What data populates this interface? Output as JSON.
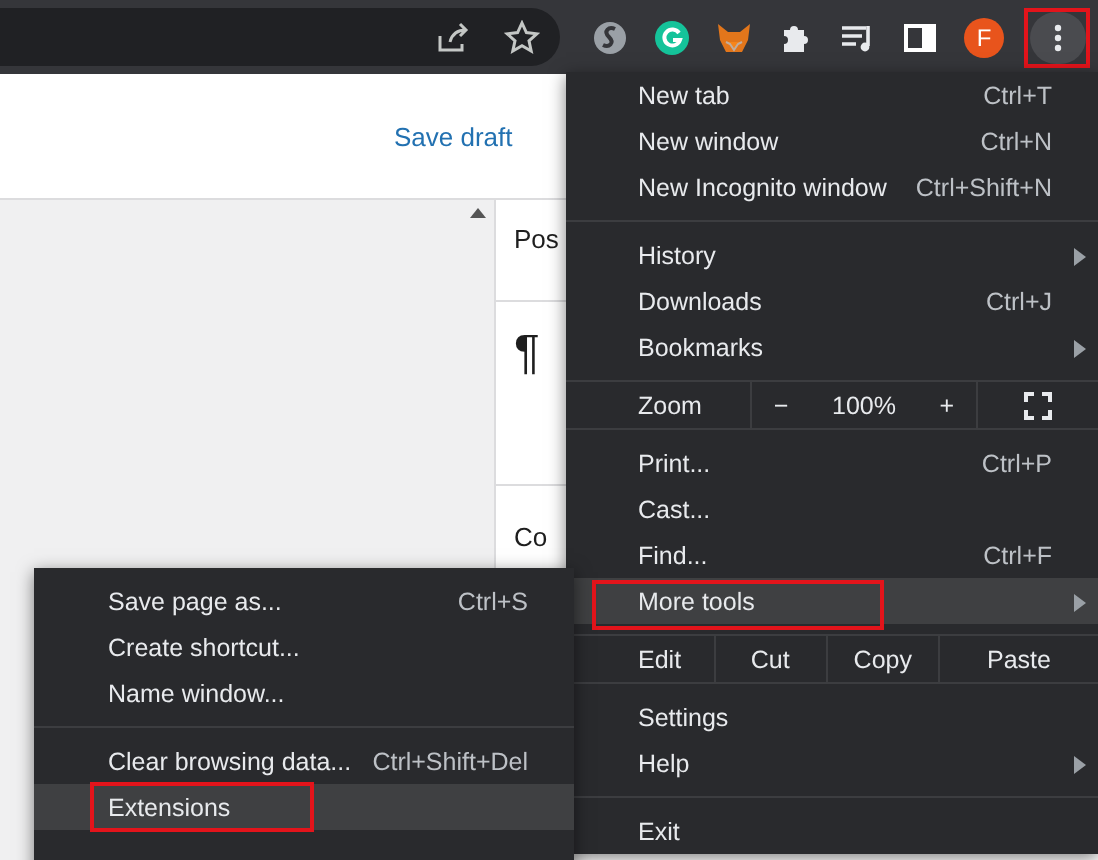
{
  "toolbar": {
    "avatar": "F",
    "menu_button": {
      "annotated": true
    }
  },
  "page": {
    "header_links": [
      "Save draft"
    ],
    "panel_texts": [
      "Pos",
      "¶",
      "Co"
    ]
  },
  "main_menu": {
    "items": [
      {
        "kind": "item",
        "label": "New tab",
        "shortcut": "Ctrl+T",
        "submenu": false,
        "hovered": false,
        "annotated": false
      },
      {
        "kind": "item",
        "label": "New window",
        "shortcut": "Ctrl+N",
        "submenu": false,
        "hovered": false,
        "annotated": false
      },
      {
        "kind": "item",
        "label": "New Incognito window",
        "shortcut": "Ctrl+Shift+N",
        "submenu": false,
        "hovered": false,
        "annotated": false
      },
      {
        "kind": "separator"
      },
      {
        "kind": "item",
        "label": "History",
        "submenu": true,
        "hovered": false,
        "annotated": false
      },
      {
        "kind": "item",
        "label": "Downloads",
        "shortcut": "Ctrl+J",
        "submenu": false,
        "hovered": false,
        "annotated": false
      },
      {
        "kind": "item",
        "label": "Bookmarks",
        "submenu": true,
        "hovered": false,
        "annotated": false
      },
      {
        "kind": "separator"
      },
      {
        "kind": "zoom",
        "label": "Zoom",
        "minus": "−",
        "value": "100%",
        "plus": "+"
      },
      {
        "kind": "separator"
      },
      {
        "kind": "item",
        "label": "Print...",
        "shortcut": "Ctrl+P",
        "submenu": false,
        "hovered": false,
        "annotated": false
      },
      {
        "kind": "item",
        "label": "Cast...",
        "submenu": false,
        "hovered": false,
        "annotated": false
      },
      {
        "kind": "item",
        "label": "Find...",
        "shortcut": "Ctrl+F",
        "submenu": false,
        "hovered": false,
        "annotated": false
      },
      {
        "kind": "item",
        "label": "More tools",
        "submenu": true,
        "hovered": true,
        "annotated": true
      },
      {
        "kind": "separator"
      },
      {
        "kind": "edit",
        "label": "Edit",
        "actions": [
          "Cut",
          "Copy",
          "Paste"
        ]
      },
      {
        "kind": "separator"
      },
      {
        "kind": "item",
        "label": "Settings",
        "submenu": false,
        "hovered": false,
        "annotated": false
      },
      {
        "kind": "item",
        "label": "Help",
        "submenu": true,
        "hovered": false,
        "annotated": false
      },
      {
        "kind": "separator"
      },
      {
        "kind": "item",
        "label": "Exit",
        "submenu": false,
        "hovered": false,
        "annotated": false
      }
    ]
  },
  "more_tools_menu": {
    "items": [
      {
        "kind": "item",
        "label": "Save page as...",
        "shortcut": "Ctrl+S",
        "hovered": false,
        "annotated": false
      },
      {
        "kind": "item",
        "label": "Create shortcut...",
        "hovered": false,
        "annotated": false
      },
      {
        "kind": "item",
        "label": "Name window...",
        "hovered": false,
        "annotated": false
      },
      {
        "kind": "separator"
      },
      {
        "kind": "item",
        "label": "Clear browsing data...",
        "shortcut": "Ctrl+Shift+Del",
        "hovered": false,
        "annotated": false
      },
      {
        "kind": "item",
        "label": "Extensions",
        "hovered": true,
        "annotated": true
      }
    ]
  }
}
